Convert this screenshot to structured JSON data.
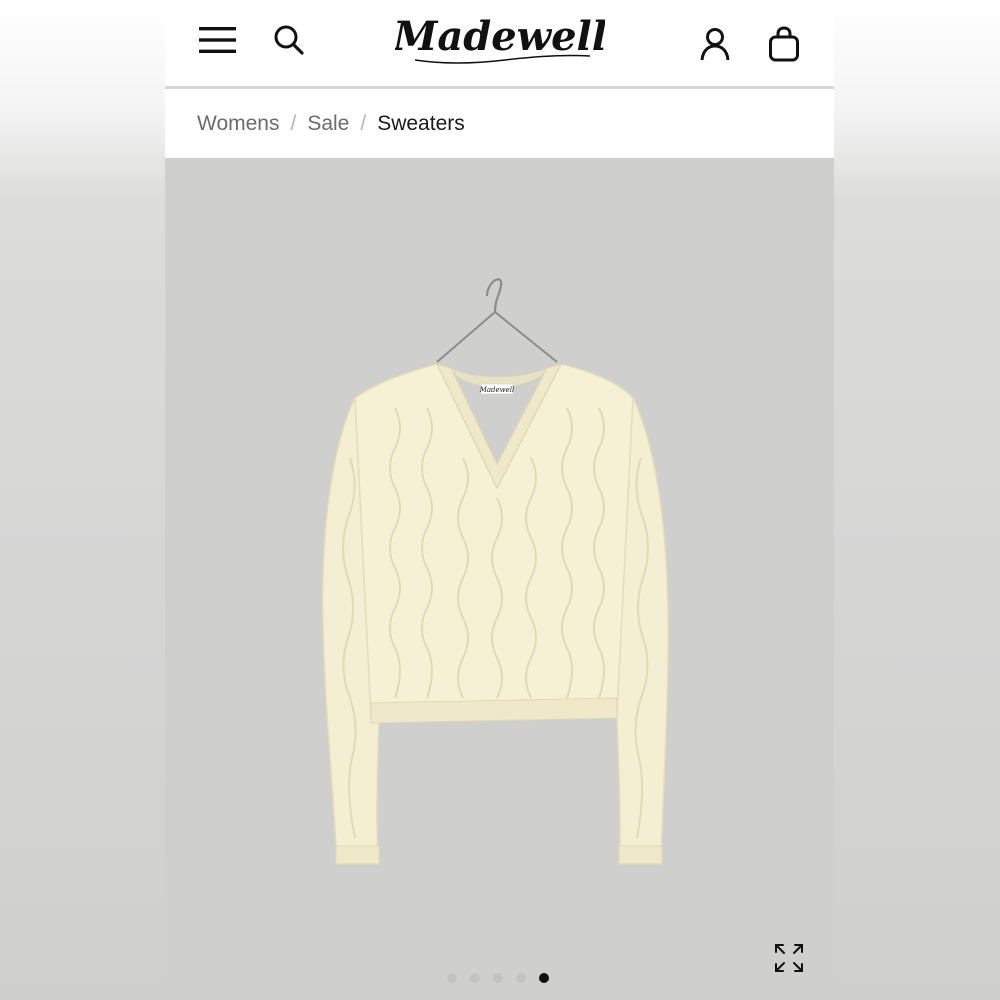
{
  "header": {
    "logo_text": "Madewell",
    "menu_icon": "hamburger-menu-icon",
    "search_icon": "search-icon",
    "account_icon": "account-icon",
    "bag_icon": "shopping-bag-icon"
  },
  "breadcrumb": {
    "items": [
      "Womens",
      "Sale",
      "Sweaters"
    ],
    "separator": "/"
  },
  "gallery": {
    "expand_icon": "expand-icon",
    "dots_count": 5,
    "active_index": 4,
    "garment_label": "Madewell"
  },
  "colors": {
    "background": "#cfcfce",
    "sweater": "#f6f0d4",
    "text_primary": "#1a1a1a",
    "text_muted": "#6b6b6b"
  }
}
